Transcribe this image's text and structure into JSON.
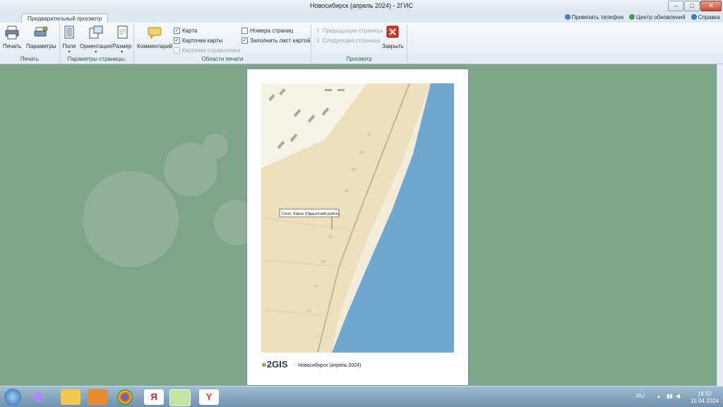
{
  "window": {
    "title": "Новосибирск (апрель 2024) - 2ГИС"
  },
  "tab": {
    "label": "Предварительный просмотр"
  },
  "toplinks": {
    "phone": "Привязать телефон",
    "updates": "Центр обновлений",
    "help": "Справка"
  },
  "ribbon": {
    "print_group": {
      "label": "Печать",
      "print": "Печать",
      "params": "Параметры"
    },
    "page_group": {
      "label": "Параметры страницы.",
      "margins": "Поля",
      "orientation": "Ориентация",
      "size": "Размер"
    },
    "area_group": {
      "label": "Области печати",
      "comments": "Комментарий",
      "map": "Карта",
      "map_cards": "Карточки карты",
      "directory_cards": "Карточки справочника",
      "page_numbers": "Номера страниц",
      "fill_map": "Заполнить лист картой"
    },
    "view_group": {
      "label": "Просмотр",
      "prev": "Предыдущая страница",
      "next": "Следующая страница",
      "close": "Закрыть"
    }
  },
  "preview": {
    "map_label": "Село: Кирза (Ордынский район)",
    "logo": "2GIS",
    "footer": "Новосибирск (апрель 2024)"
  },
  "taskbar": {
    "lang": "RU",
    "time": "16:52",
    "date": "15.04.2024"
  }
}
